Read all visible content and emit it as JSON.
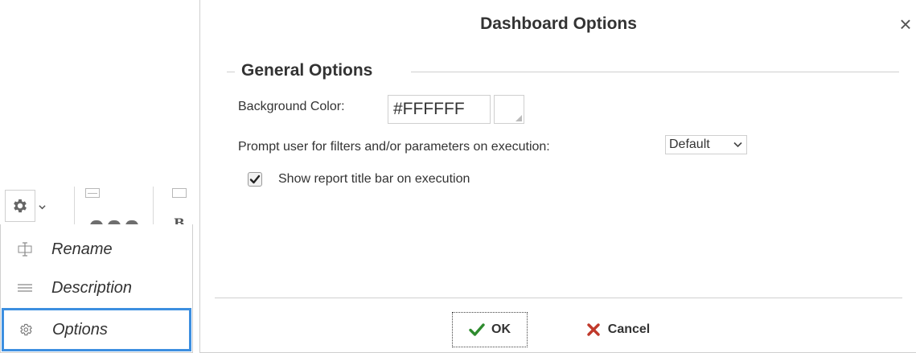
{
  "toolbar": {
    "gear_icon": "gear-icon",
    "caret_icon": "chevron-down-icon",
    "partial_glyph": "B"
  },
  "menu": {
    "items": [
      {
        "label": "Rename",
        "icon": "rename-icon"
      },
      {
        "label": "Description",
        "icon": "description-icon"
      },
      {
        "label": "Options",
        "icon": "gear-outline-icon"
      }
    ],
    "selected": "Options",
    "selected_border_color": "#3d8fe0"
  },
  "dialog": {
    "title": "Dashboard Options",
    "close_glyph": "×",
    "section_title": "General Options",
    "background_color": {
      "label": "Background Color:",
      "value": "#FFFFFF"
    },
    "prompt": {
      "label": "Prompt user for filters and/or parameters on execution:",
      "selected": "Default"
    },
    "show_title_bar": {
      "label": "Show report title bar on execution",
      "checked": true
    },
    "ok_label": "OK",
    "cancel_label": "Cancel",
    "ok_color": "#2e8b2e",
    "cancel_color": "#c0392b"
  }
}
